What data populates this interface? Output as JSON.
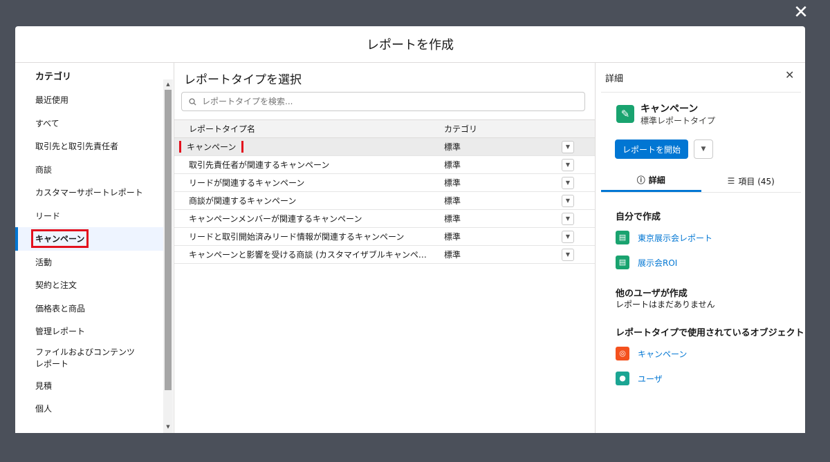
{
  "modal": {
    "title": "レポートを作成"
  },
  "categories": {
    "title": "カテゴリ",
    "items": [
      "最近使用",
      "すべて",
      "取引先と取引先責任者",
      "商談",
      "カスタマーサポートレポート",
      "リード",
      "キャンペーン",
      "活動",
      "契約と注文",
      "価格表と商品",
      "管理レポート",
      "ファイルおよびコンテンツレポート",
      "見積",
      "個人"
    ],
    "active": "キャンペーン"
  },
  "report_types": {
    "title": "レポートタイプを選択",
    "search_placeholder": "レポートタイプを検索...",
    "columns": {
      "name": "レポートタイプ名",
      "category": "カテゴリ"
    },
    "rows": [
      {
        "name": "キャンペーン",
        "category": "標準"
      },
      {
        "name": "取引先責任者が関連するキャンペーン",
        "category": "標準"
      },
      {
        "name": "リードが関連するキャンペーン",
        "category": "標準"
      },
      {
        "name": "商談が関連するキャンペーン",
        "category": "標準"
      },
      {
        "name": "キャンペーンメンバーが関連するキャンペーン",
        "category": "標準"
      },
      {
        "name": "リードと取引開始済みリード情報が関連するキャンペーン",
        "category": "標準"
      },
      {
        "name": "キャンペーンと影響を受ける商談 (カスタマイザブルキャンペーン...",
        "category": "標準"
      }
    ]
  },
  "details": {
    "header": "詳細",
    "object_title": "キャンペーン",
    "object_subtitle": "標準レポートタイプ",
    "start_button": "レポートを開始",
    "tabs": {
      "details": "詳細",
      "fields": "項目 (45)"
    },
    "created_by_me": {
      "title": "自分で作成",
      "items": [
        "東京展示会レポート",
        "展示会ROI"
      ]
    },
    "created_by_others": {
      "title": "他のユーザが作成",
      "text": "レポートはまだありません"
    },
    "objects": {
      "title": "レポートタイプで使用されているオブジェクト",
      "items": [
        "キャンペーン",
        "ユーザ"
      ]
    },
    "colors": {
      "accent": "#0176d3",
      "highlight": "#e3101d",
      "icon_green": "#19a36f",
      "icon_orange": "#f4511e"
    }
  }
}
